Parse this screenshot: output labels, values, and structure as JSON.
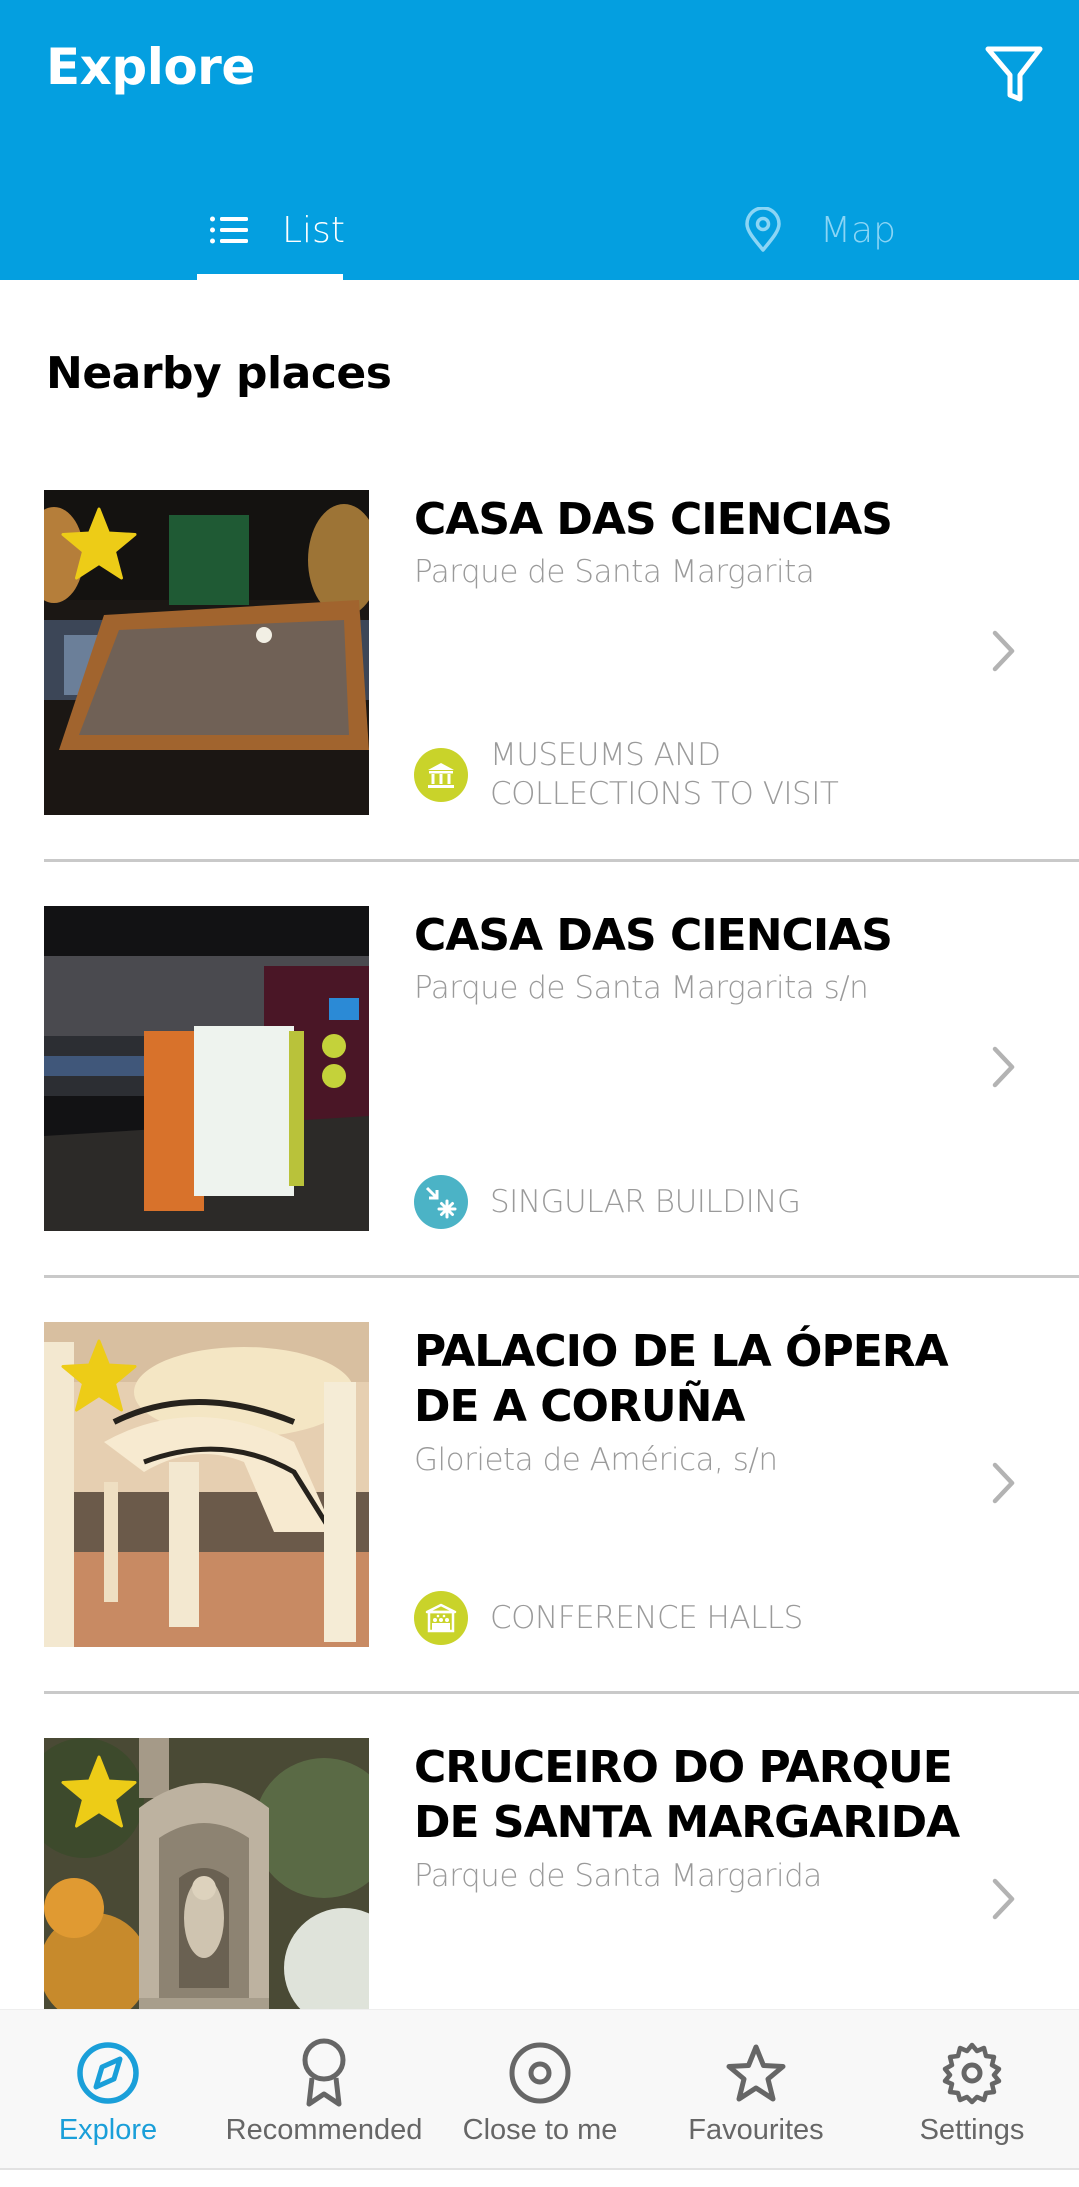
{
  "app": {
    "title": "Explore",
    "header_color": "#049fe0",
    "filter_icon": "filter-funnel-icon"
  },
  "tabs": [
    {
      "label": "List",
      "icon": "list-icon",
      "active": true
    },
    {
      "label": "Map",
      "icon": "map-pin-icon",
      "active": false
    }
  ],
  "section": {
    "title": "Nearby places"
  },
  "places": [
    {
      "title": "CASA DAS CIENCIAS",
      "address": "Parque de Santa Margarita",
      "category": "MUSEUMS AND COLLECTIONS TO VISIT",
      "category_icon": "museum-icon",
      "category_color": "#c9d32a",
      "favourite": true,
      "image": "museum-display-case-photo"
    },
    {
      "title": "CASA DAS CIENCIAS",
      "address": "Parque de Santa Margarita s/n",
      "category": "SINGULAR BUILDING",
      "category_icon": "singular-building-icon",
      "category_color": "#4bb3c6",
      "favourite": false,
      "image": "exhibition-hall-photo"
    },
    {
      "title": "PALACIO DE LA ÓPERA DE A CORUÑA",
      "address": "Glorieta de América, s/n",
      "category": "CONFERENCE HALLS",
      "category_icon": "conference-hall-icon",
      "category_color": "#c9d32a",
      "favourite": true,
      "image": "opera-lobby-staircase-photo"
    },
    {
      "title": "CRUCEIRO DO PARQUE DE SANTA MARGARIDA",
      "address": "Parque de Santa Margarida",
      "category": "",
      "category_icon": "",
      "category_color": "",
      "favourite": true,
      "image": "stone-cross-shrine-photo"
    }
  ],
  "bottom_nav": [
    {
      "label": "Explore",
      "icon": "compass-icon",
      "active": true
    },
    {
      "label": "Recommended",
      "icon": "award-ribbon-icon",
      "active": false
    },
    {
      "label": "Close to me",
      "icon": "target-location-icon",
      "active": false
    },
    {
      "label": "Favourites",
      "icon": "star-outline-icon",
      "active": false
    },
    {
      "label": "Settings",
      "icon": "gear-icon",
      "active": false
    }
  ],
  "colors": {
    "accent": "#1a9fd9",
    "favourite_star": "#edcc17",
    "inactive_tab_text": "#8bd5f5",
    "secondary_text": "#9a9a9a",
    "nav_inactive": "#666666"
  }
}
